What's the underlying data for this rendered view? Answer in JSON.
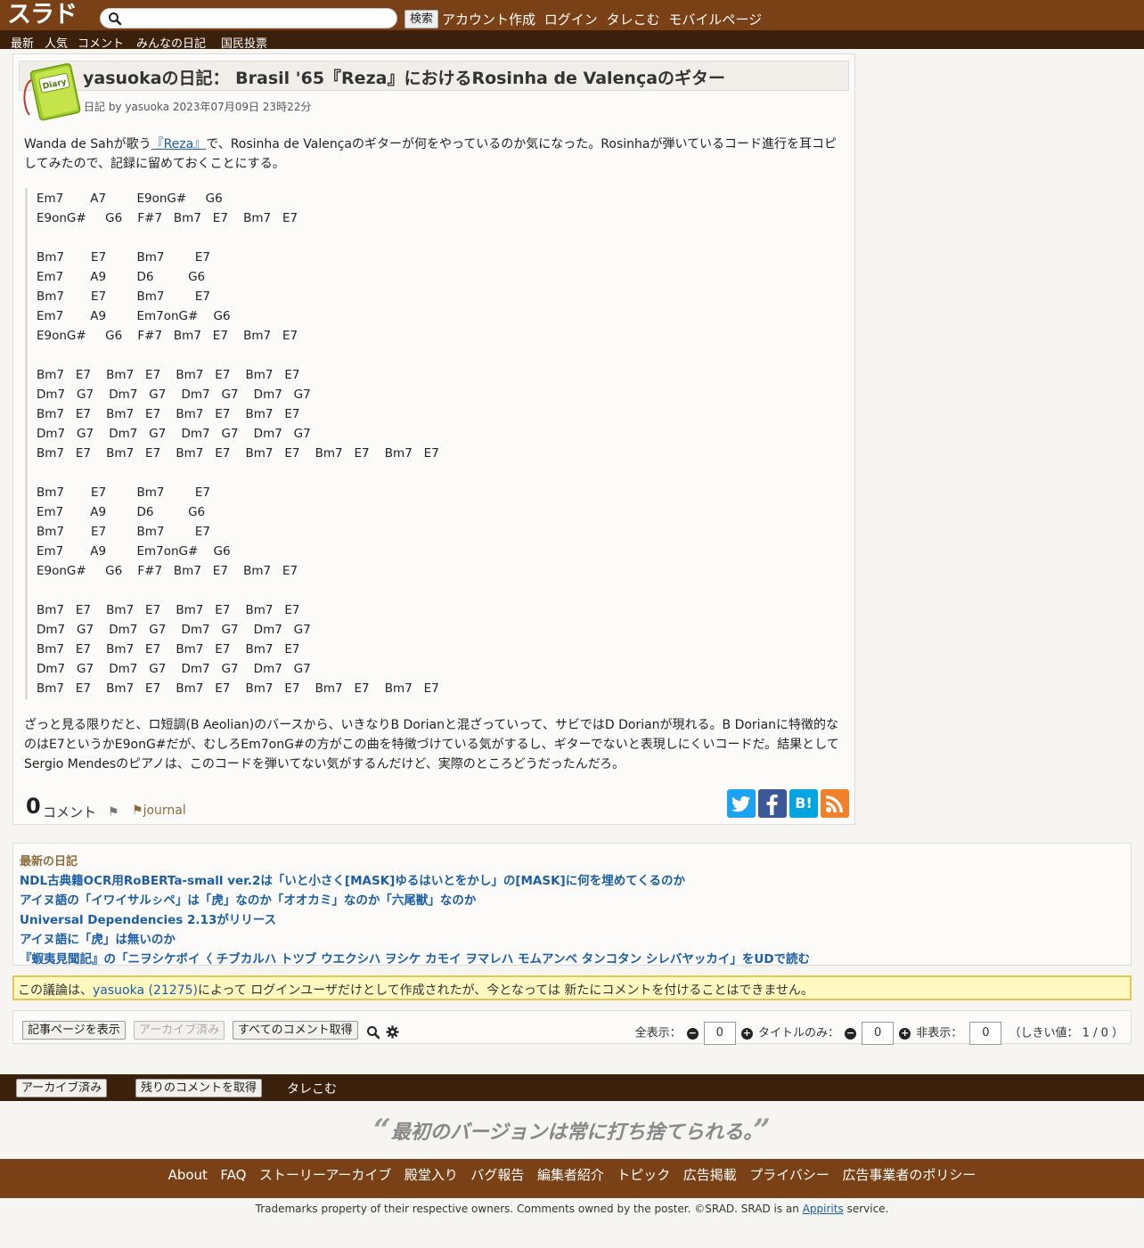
{
  "header": {
    "logo": "スラド",
    "search_placeholder": "",
    "search_button": "検索",
    "links": [
      "アカウント作成",
      "ログイン",
      "タレこむ",
      "モバイルページ"
    ]
  },
  "nav": {
    "items": [
      "最新",
      "人気",
      "コメント",
      "みんなの日記",
      "国民投票"
    ]
  },
  "article": {
    "title": "yasuokaの日記： Brasil '65『Reza』におけるRosinha de Valençaのギター",
    "meta": "日記 by yasuoka 2023年07月09日 23時22分",
    "intro_before": "Wanda de Sahが歌う",
    "intro_link": "『Reza』",
    "intro_after": "で、Rosinha de Valençaのギターが何をやっているのか気になった。Rosinhaが弾いているコード進行を耳コピしてみたので、記録に留めておくことにする。",
    "chords": "Em7       A7        E9onG#     G6\nE9onG#     G6    F#7   Bm7   E7    Bm7   E7\n\nBm7       E7        Bm7        E7\nEm7       A9        D6         G6\nBm7       E7        Bm7        E7\nEm7       A9        Em7onG#    G6\nE9onG#     G6    F#7   Bm7   E7    Bm7   E7\n\nBm7   E7    Bm7   E7    Bm7   E7    Bm7   E7\nDm7   G7    Dm7   G7    Dm7   G7    Dm7   G7\nBm7   E7    Bm7   E7    Bm7   E7    Bm7   E7\nDm7   G7    Dm7   G7    Dm7   G7    Dm7   G7\nBm7   E7    Bm7   E7    Bm7   E7    Bm7   E7    Bm7   E7    Bm7   E7\n\nBm7       E7        Bm7        E7\nEm7       A9        D6         G6\nBm7       E7        Bm7        E7\nEm7       A9        Em7onG#    G6\nE9onG#     G6    F#7   Bm7   E7    Bm7   E7\n\nBm7   E7    Bm7   E7    Bm7   E7    Bm7   E7\nDm7   G7    Dm7   G7    Dm7   G7    Dm7   G7\nBm7   E7    Bm7   E7    Bm7   E7    Bm7   E7\nDm7   G7    Dm7   G7    Dm7   G7    Dm7   G7\nBm7   E7    Bm7   E7    Bm7   E7    Bm7   E7    Bm7   E7    Bm7   E7",
    "outro": "ざっと見る限りだと、ロ短調(B Aeolian)のバースから、いきなりB Dorianと混ざっていって、サビではD Dorianが現れる。B Dorianに特徴的なのはE7というかE9onG#だが、むしろEm7onG#の方がこの曲を特徴づけている気がするし、ギターでないと表現しにくいコードだ。結果としてSergio Mendesのピアノは、このコードを弾いてない気がするんだけど、実際のところどうだったんだろ。",
    "comment_count": "0",
    "comment_label": "コメント",
    "tag": "journal",
    "diary_icon_text": "Diary"
  },
  "share": {
    "twitter": "t",
    "facebook": "f",
    "hatena": "B!",
    "rss": "rss"
  },
  "recent": {
    "heading": "最新の日記",
    "items": [
      "NDL古典籍OCR用RoBERTa-small ver.2は「いと小さく[MASK]ゆるはいとをかし」の[MASK]に何を埋めてくるのか",
      "アイヌ語の「イワイサルㇱペ」は「虎」なのか「オオカミ」なのか「六尾獣」なのか",
      "Universal Dependencies 2.13がリリース",
      "アイヌ語に「虎」は無いのか",
      "『蝦夷見聞記』の「ニヲシケボイ〈 チブカルハ トツブ ウエクシハ ヲシケ カモイ ヲマレハ モムアンベ タンコタン シレバヤッカイ」をUDで読む"
    ]
  },
  "notice": {
    "before": "この議論は、",
    "user": "yasuoka (21275)",
    "after": "によって ログインユーザだけとして作成されたが、今となっては 新たにコメントを付けることはできません。"
  },
  "controls": {
    "view_article": "記事ページを表示",
    "archived": "アーカイブ済み",
    "get_all": "すべてのコメント取得",
    "show_all": "全表示：",
    "show_all_value": "0",
    "title_only": "タイトルのみ：",
    "title_only_value": "0",
    "hidden": "非表示：",
    "hidden_value": "0",
    "threshold": "（しきい値： 1 / 0 ）"
  },
  "footer": {
    "archived": "アーカイブ済み",
    "get_rest": "残りのコメントを取得",
    "talecomm": "タレこむ",
    "quote": "最初のバージョンは常に打ち捨てられる。",
    "links": [
      "About",
      "FAQ",
      "ストーリーアーカイブ",
      "殿堂入り",
      "バグ報告",
      "編集者紹介",
      "トピック",
      "広告掲載",
      "プライバシー",
      "広告事業者のポリシー"
    ],
    "copyright_before": "Trademarks property of their respective owners. Comments owned by the poster. ©SRAD. SRAD is an",
    "copyright_link": "Appirits",
    "copyright_after": "service."
  },
  "colors": {
    "topbar": "#7a4116",
    "navbar": "#3b200c",
    "link": "#1a5fa6",
    "notice_bg": "#fff8c0",
    "twitter": "#1da1f2",
    "facebook": "#3b5998",
    "hatena": "#00a4de",
    "rss": "#f0802a"
  }
}
